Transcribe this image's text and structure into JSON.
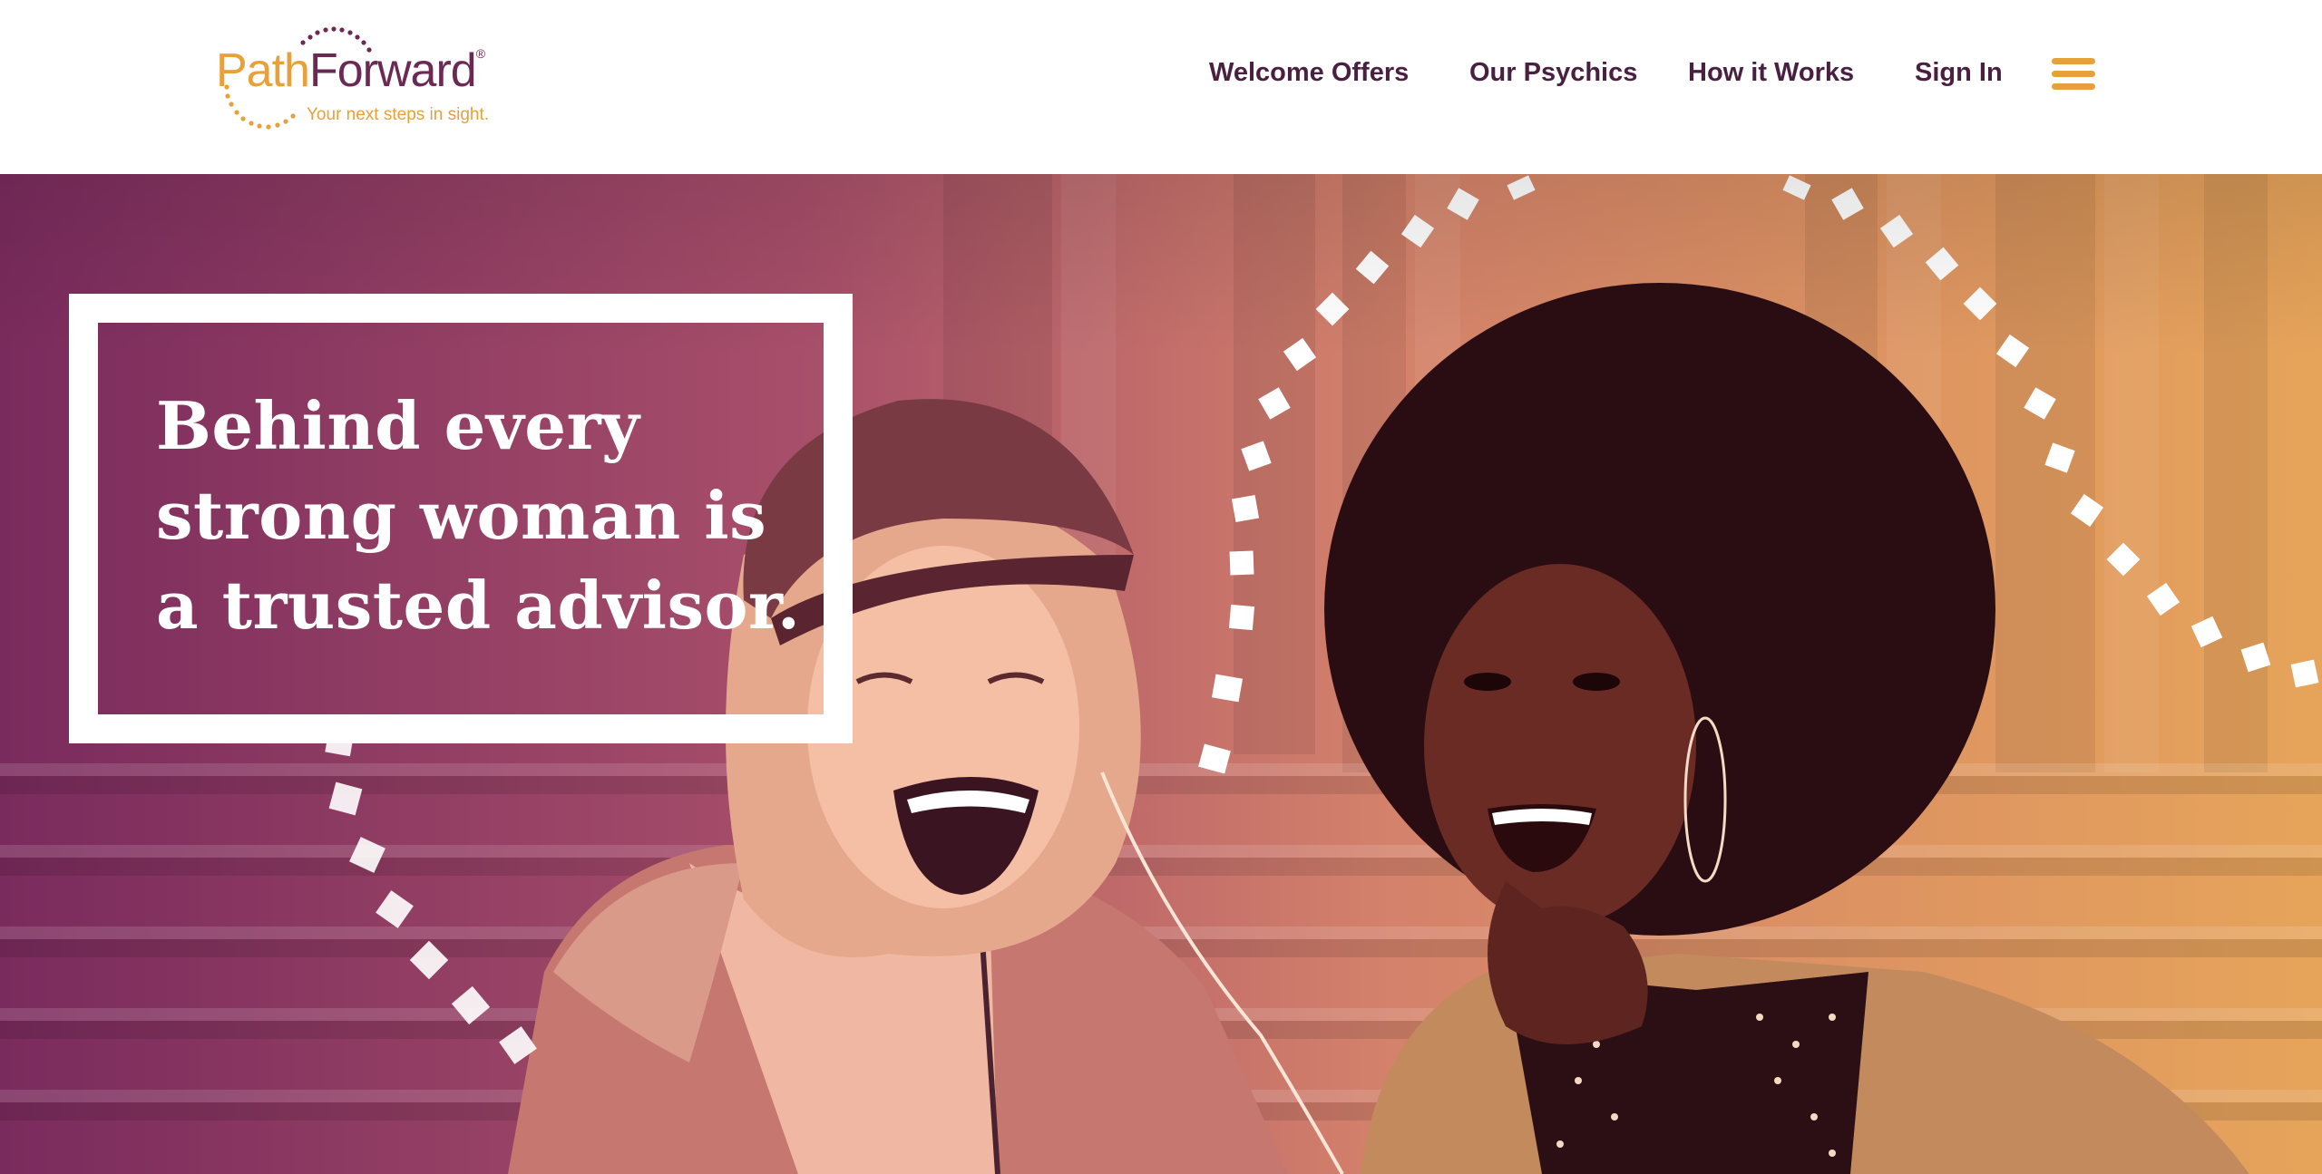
{
  "brand": {
    "name_part1": "Path",
    "name_part2": "Forward",
    "registered_mark": "®",
    "tagline": "Your next steps in sight."
  },
  "nav": {
    "items": [
      {
        "label": "Welcome Offers"
      },
      {
        "label": "Our Psychics"
      },
      {
        "label": "How it Works"
      },
      {
        "label": "Sign In"
      }
    ],
    "menu_icon": "hamburger-menu-icon"
  },
  "hero": {
    "headline": "Behind every strong woman is a trusted advisor.",
    "headline_lines": [
      "Behind every",
      "strong woman is",
      "a trusted advisor."
    ]
  },
  "colors": {
    "brand_gold": "#e8a03a",
    "brand_plum": "#6b2a53",
    "nav_text": "#4a2040",
    "hero_gradient_left": "#7a2b5d",
    "hero_gradient_right": "#e5a35a",
    "white": "#ffffff"
  }
}
